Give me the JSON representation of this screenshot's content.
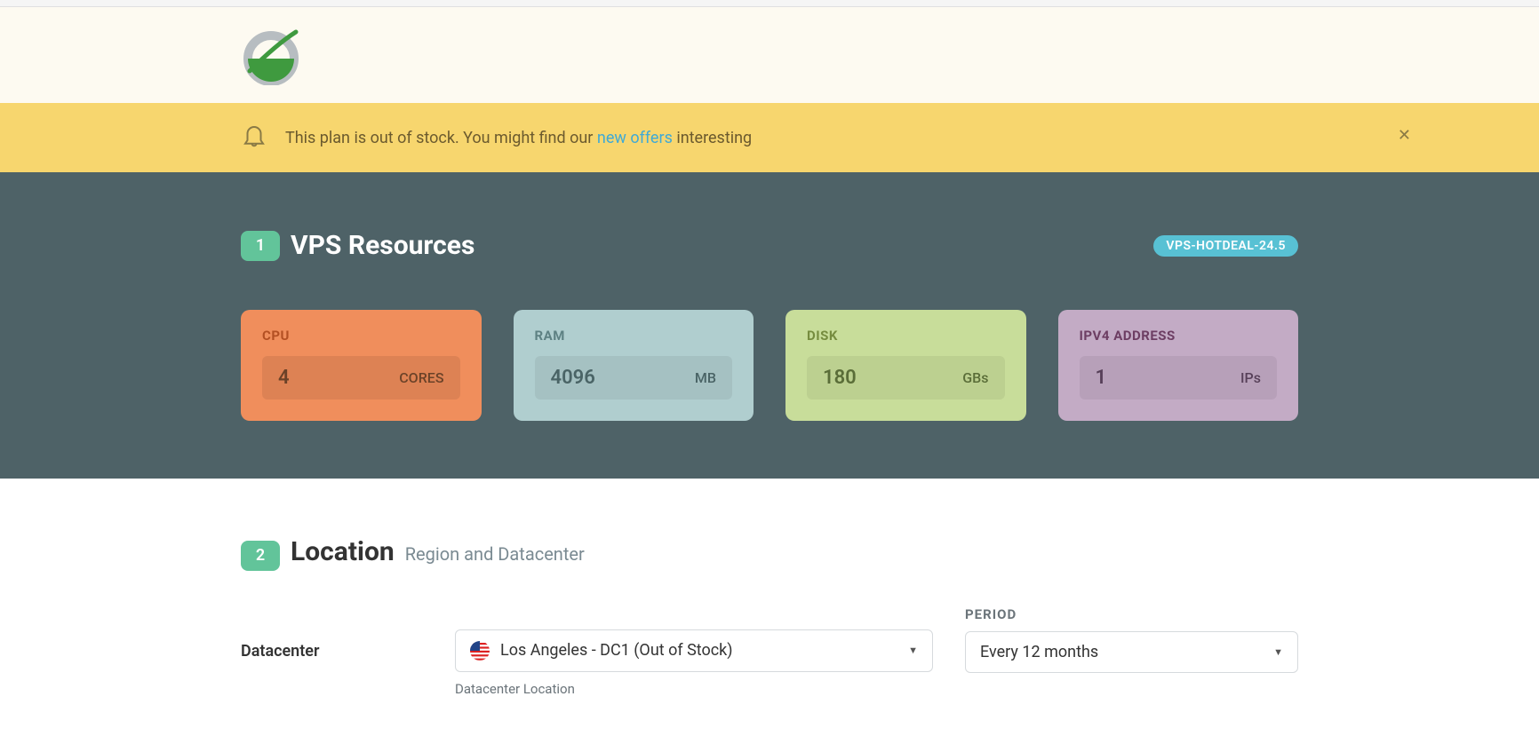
{
  "alert": {
    "text_pre": "This plan is out of stock. You might find our ",
    "link_text": "new offers",
    "text_post": " interesting"
  },
  "section1": {
    "step": "1",
    "title": "VPS Resources",
    "plan_badge": "VPS-HOTDEAL-24.5",
    "cards": {
      "cpu": {
        "label": "CPU",
        "value": "4",
        "unit": "CORES"
      },
      "ram": {
        "label": "RAM",
        "value": "4096",
        "unit": "MB"
      },
      "disk": {
        "label": "DISK",
        "value": "180",
        "unit": "GBs"
      },
      "ip": {
        "label": "IPV4 ADDRESS",
        "value": "1",
        "unit": "IPs"
      }
    }
  },
  "section2": {
    "step": "2",
    "title": "Location",
    "subtitle": "Region and Datacenter",
    "datacenter_label": "Datacenter",
    "datacenter_value": "Los Angeles - DC1 (Out of Stock)",
    "datacenter_caption": "Datacenter Location",
    "period_label": "PERIOD",
    "period_value": "Every 12 months"
  }
}
